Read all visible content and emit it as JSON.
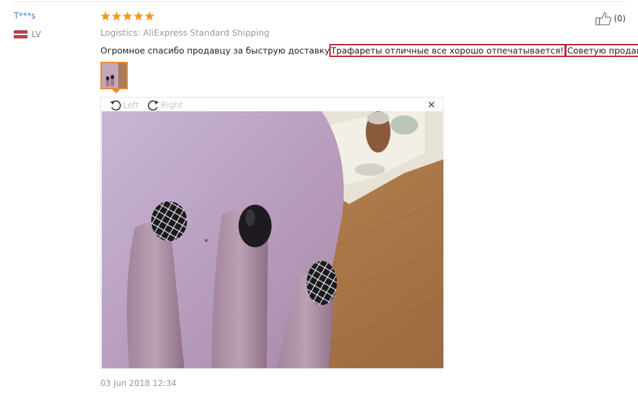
{
  "reviewer": {
    "name": "T***s",
    "country_code": "LV",
    "flag_colors": [
      "#b5434f",
      "#ffffff",
      "#b5434f"
    ]
  },
  "rating": {
    "stars": 5,
    "max": 5,
    "color": "#f39a1c"
  },
  "logistics": "Logistics: AliExpress Standard Shipping",
  "review": {
    "part1": "Огромное спасибо продавцу за быструю доставку",
    "part2": "Трафареты отличные все хорошо отпечатывается!",
    "part3": "Советую продавца!",
    "highlight_color": "#c0242f"
  },
  "helpful": {
    "count_label": "(0)",
    "icon": "thumbs-up-icon"
  },
  "photo_viewer": {
    "rotate_left_label": "Left",
    "rotate_right_label": "Right",
    "close_symbol": "×",
    "thumbnail_border_color": "#e88c33"
  },
  "date": "03 Jun 2018 12:34"
}
